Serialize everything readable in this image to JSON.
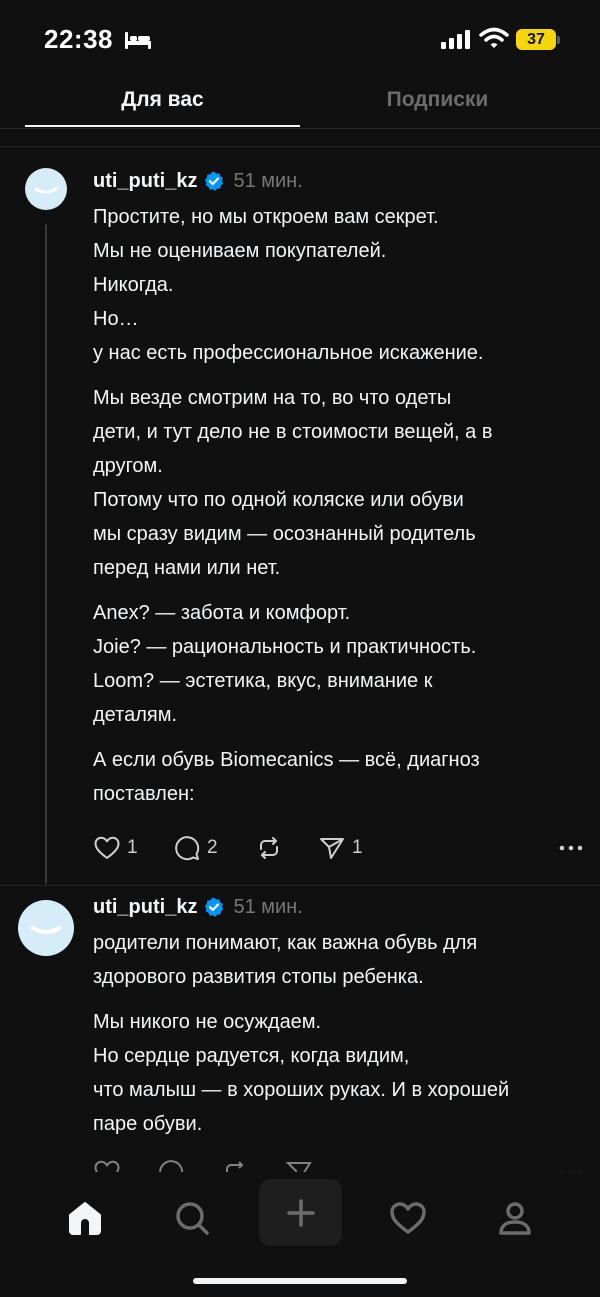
{
  "status": {
    "time": "22:38",
    "battery": "37"
  },
  "tabs": [
    {
      "label": "Для вас",
      "active": true
    },
    {
      "label": "Подписки",
      "active": false
    }
  ],
  "posts": [
    {
      "username": "uti_puti_kz",
      "time": "51 мин.",
      "paragraphs": [
        [
          "Простите, но мы откроем вам секрет.",
          "Мы не оцениваем покупателей.",
          "Никогда.",
          "Но…",
          "у нас есть профессиональное искажение."
        ],
        [
          "Мы везде смотрим на то, во что одеты",
          "дети, и тут дело не в стоимости вещей, а в",
          "другом.",
          "Потому что по одной коляске или обуви",
          "мы сразу видим — осознанный родитель",
          "перед нами или нет."
        ],
        [
          "Anex? — забота и комфорт.",
          "Joie? — рациональность и практичность.",
          "Loom? — эстетика, вкус, внимание к",
          "деталям."
        ],
        [
          "А если обувь Biomecanics — всё, диагноз",
          "поставлен:"
        ]
      ],
      "likes": "1",
      "replies": "2",
      "shares": "1"
    },
    {
      "username": "uti_puti_kz",
      "time": "51 мин.",
      "paragraphs": [
        [
          "родители понимают, как важна обувь для",
          "здорового развития стопы ребенка."
        ],
        [
          "Мы никого не осуждаем.",
          "Но сердце радуется, когда видим,",
          "что малыш — в хороших руках. И в хорошей",
          "паре обуви."
        ]
      ]
    }
  ],
  "colors": {
    "background": "#101010",
    "text": "#f3f5f7",
    "muted": "#777777",
    "verified": "#0095f6",
    "battery": "#f5d60a",
    "avatar": "#d6ecf8"
  },
  "icons": {
    "home": "home-icon",
    "search": "search-icon",
    "compose": "plus-icon",
    "activity": "heart-icon",
    "profile": "person-icon"
  }
}
